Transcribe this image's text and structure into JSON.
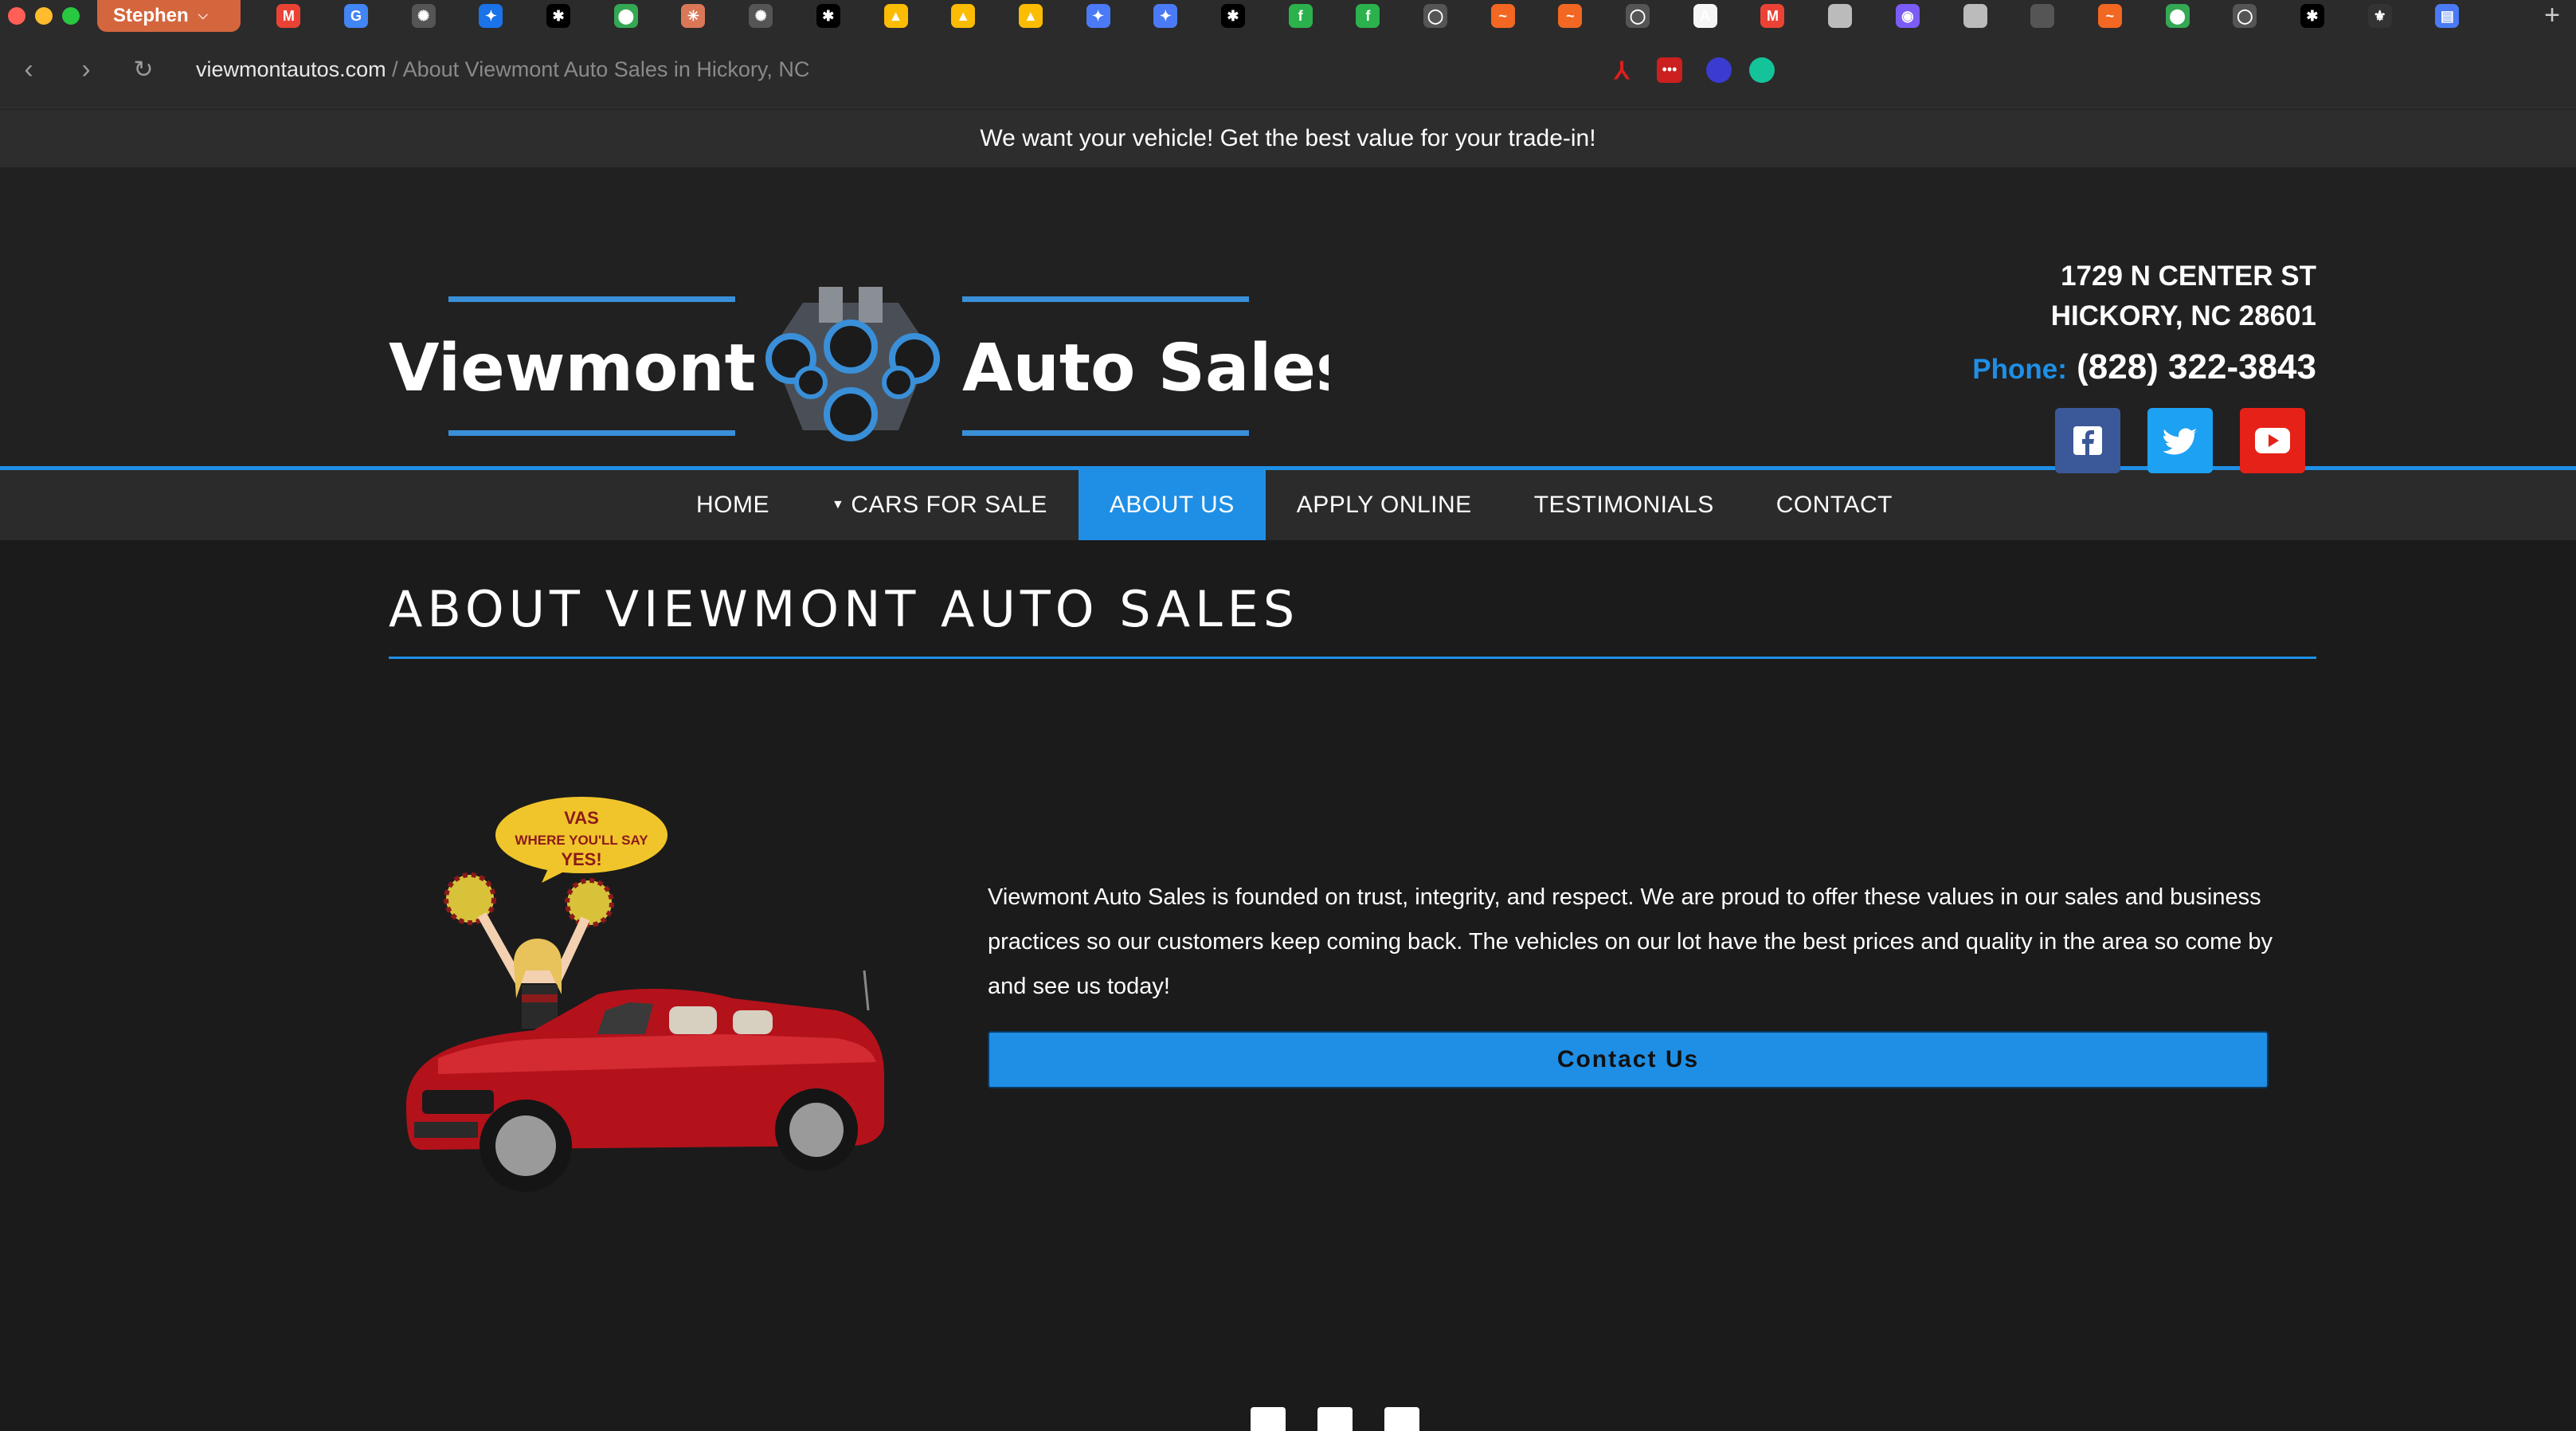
{
  "browser": {
    "profile_name": "Stephen",
    "url_domain": "viewmontautos.com",
    "url_rest": " / About Viewmont Auto Sales in Hickory, NC",
    "tabs": [
      {
        "icon": "gmail-icon",
        "color": "#ea4335",
        "glyph": "M"
      },
      {
        "icon": "google-icon",
        "color": "#4285f4",
        "glyph": "G"
      },
      {
        "icon": "openai-icon",
        "color": "#555",
        "glyph": "✺"
      },
      {
        "icon": "playstation-icon",
        "color": "#1a73e8",
        "glyph": "✦"
      },
      {
        "icon": "app-icon",
        "color": "#000",
        "glyph": "✱"
      },
      {
        "icon": "maps-icon",
        "color": "#34a853",
        "glyph": "⬤"
      },
      {
        "icon": "claude-icon",
        "color": "#d97757",
        "glyph": "✳"
      },
      {
        "icon": "openai-icon",
        "color": "#555",
        "glyph": "✺"
      },
      {
        "icon": "app-icon",
        "color": "#000",
        "glyph": "✱"
      },
      {
        "icon": "drive-icon",
        "color": "#fbbc04",
        "glyph": "▲"
      },
      {
        "icon": "drive-icon",
        "color": "#fbbc04",
        "glyph": "▲"
      },
      {
        "icon": "drive-icon",
        "color": "#fbbc04",
        "glyph": "▲"
      },
      {
        "icon": "gemini-icon",
        "color": "#4a7af5",
        "glyph": "✦"
      },
      {
        "icon": "gemini-icon",
        "color": "#4a7af5",
        "glyph": "✦"
      },
      {
        "icon": "app-icon",
        "color": "#000",
        "glyph": "✱"
      },
      {
        "icon": "feedly-icon",
        "color": "#2bb24c",
        "glyph": "f"
      },
      {
        "icon": "feedly-icon",
        "color": "#2bb24c",
        "glyph": "f"
      },
      {
        "icon": "chat-icon",
        "color": "#555",
        "glyph": "◯"
      },
      {
        "icon": "orange-app-icon",
        "color": "#f26722",
        "glyph": "~"
      },
      {
        "icon": "orange-app-icon",
        "color": "#f26722",
        "glyph": "~"
      },
      {
        "icon": "chat-icon",
        "color": "#555",
        "glyph": "◯"
      },
      {
        "icon": "anthropic-icon",
        "color": "#f5f5f5",
        "glyph": "A"
      },
      {
        "icon": "gmail-icon",
        "color": "#ea4335",
        "glyph": "M"
      },
      {
        "icon": "gray-circle-icon",
        "color": "#bbb",
        "glyph": ""
      },
      {
        "icon": "discord-icon",
        "color": "#7b5cf5",
        "glyph": "◉"
      },
      {
        "icon": "gray-circle-icon",
        "color": "#bbb",
        "glyph": ""
      },
      {
        "icon": "gray-square-icon",
        "color": "#555",
        "glyph": ""
      },
      {
        "icon": "orange-app-icon",
        "color": "#f26722",
        "glyph": "~"
      },
      {
        "icon": "maps-icon",
        "color": "#34a853",
        "glyph": "⬤"
      },
      {
        "icon": "chat-icon",
        "color": "#555",
        "glyph": "◯"
      },
      {
        "icon": "app-icon",
        "color": "#000",
        "glyph": "✱"
      },
      {
        "icon": "bbb-icon",
        "color": "#333",
        "glyph": "⚜"
      },
      {
        "icon": "document-icon",
        "color": "#4a7af5",
        "glyph": "▤"
      }
    ]
  },
  "site": {
    "promo": "We want your vehicle! Get the best value for your trade-in!",
    "brand_left": "Viewmont",
    "brand_right": "Auto Sales",
    "address_line1": "1729 N CENTER ST",
    "address_line2": "HICKORY, NC 28601",
    "phone_label": "Phone:",
    "phone_number": "(828) 322-3843",
    "social": {
      "facebook_color": "#3b5998",
      "twitter_color": "#1da1f2",
      "youtube_color": "#e62117"
    },
    "nav": [
      "HOME",
      "CARS FOR SALE",
      "ABOUT US",
      "APPLY ONLINE",
      "TESTIMONIALS",
      "CONTACT"
    ],
    "active_nav": "ABOUT US",
    "page_title": "ABOUT VIEWMONT AUTO SALES",
    "bubble_line1": "VAS",
    "bubble_line2": "WHERE YOU'LL SAY",
    "bubble_line3": "YES!",
    "about_text": "Viewmont Auto Sales is founded on trust, integrity, and respect. We are proud to offer these values in our sales and business practices so our customers keep coming back. The vehicles on our lot have the best prices and quality in the area so come by and see us today!",
    "cta_label": "Contact Us",
    "accent_color": "#1f8fe6"
  }
}
